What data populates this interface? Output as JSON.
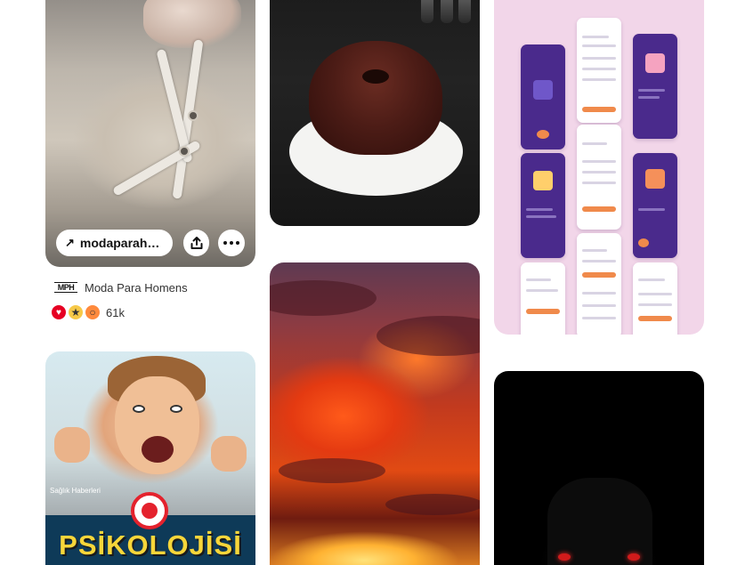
{
  "pins": {
    "shoe": {
      "link_label": "modaparah…",
      "author_avatar_text": "MPH",
      "author_name": "Moda Para Homens",
      "reaction_count": "61k",
      "icons": [
        "arrow-up-right-icon",
        "share-icon",
        "more-dots-icon"
      ],
      "reactions": [
        "heart-eyes-icon",
        "star-struck-icon",
        "wow-icon"
      ]
    },
    "kid_poster": {
      "corner_label": "Sağlık Haberleri",
      "banner_text": "PSİKOLOJİSİ"
    },
    "cake": {},
    "sunset": {},
    "app_design": {},
    "dark_figure": {}
  },
  "colors": {
    "accent_red": "#e60023",
    "app_bg": "#f2d6e9",
    "app_purple": "#4a2a8c",
    "banner_yellow": "#f7d63a"
  }
}
